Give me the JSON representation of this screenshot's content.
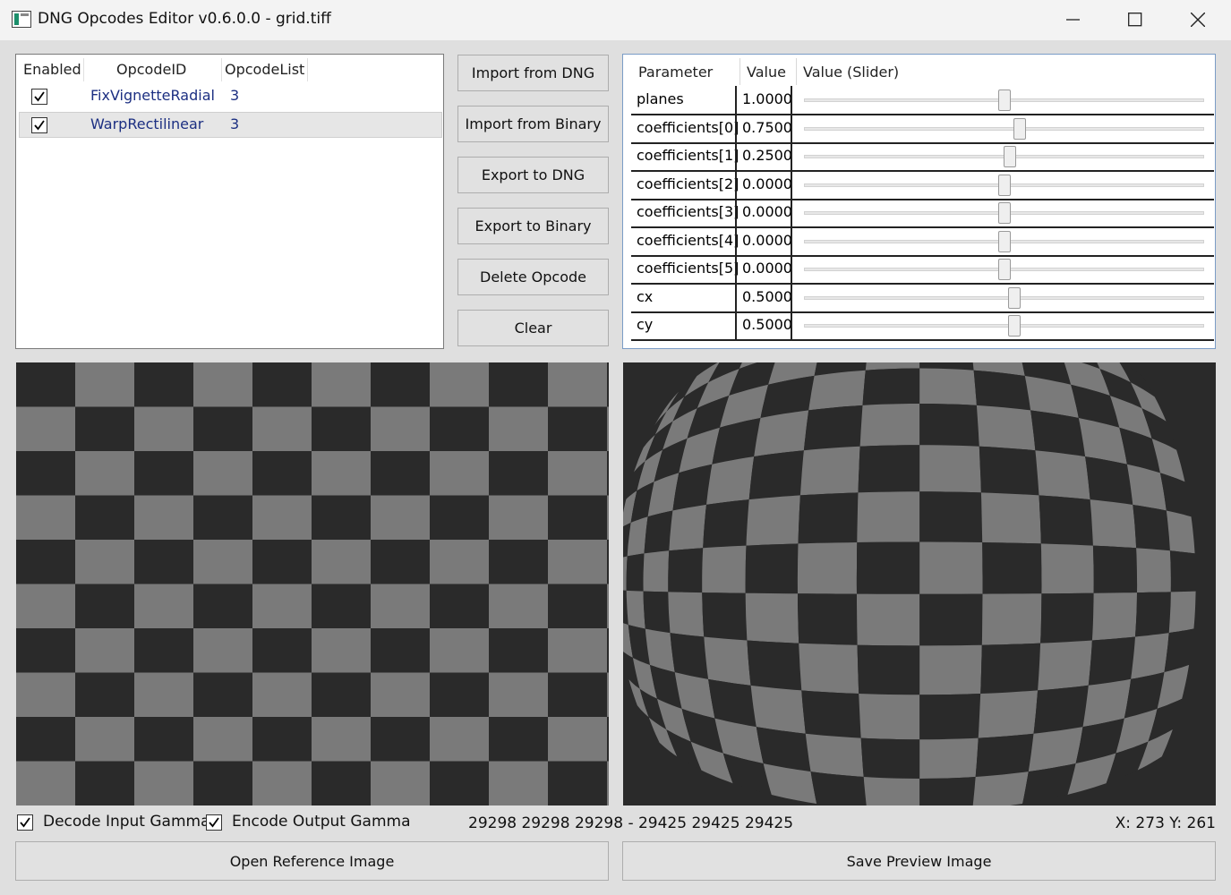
{
  "window": {
    "title": "DNG Opcodes Editor v0.6.0.0 - grid.tiff"
  },
  "opcode_list": {
    "columns": [
      "Enabled",
      "OpcodeID",
      "OpcodeList"
    ],
    "rows": [
      {
        "enabled": true,
        "opcode_id": "FixVignetteRadial",
        "opcode_list": "3"
      },
      {
        "enabled": true,
        "opcode_id": "WarpRectilinear",
        "opcode_list": "3",
        "selected": true
      }
    ]
  },
  "actions": {
    "import_dng": "Import from DNG",
    "import_binary": "Import from Binary",
    "export_dng": "Export to DNG",
    "export_binary": "Export to Binary",
    "delete_opcode": "Delete Opcode",
    "clear": "Clear"
  },
  "parameters": {
    "columns": [
      "Parameter",
      "Value",
      "Value (Slider)"
    ],
    "rows": [
      {
        "name": "planes",
        "value": "1.0000",
        "slider_fraction": 0.5
      },
      {
        "name": "coefficients[0]",
        "value": "0.7500",
        "slider_fraction": 0.54
      },
      {
        "name": "coefficients[1]",
        "value": "0.2500",
        "slider_fraction": 0.515
      },
      {
        "name": "coefficients[2]",
        "value": "0.0000",
        "slider_fraction": 0.5
      },
      {
        "name": "coefficients[3]",
        "value": "0.0000",
        "slider_fraction": 0.5
      },
      {
        "name": "coefficients[4]",
        "value": "0.0000",
        "slider_fraction": 0.5
      },
      {
        "name": "coefficients[5]",
        "value": "0.0000",
        "slider_fraction": 0.5
      },
      {
        "name": "cx",
        "value": "0.5000",
        "slider_fraction": 0.525
      },
      {
        "name": "cy",
        "value": "0.5000",
        "slider_fraction": 0.525
      }
    ]
  },
  "options": {
    "decode_input_gamma": {
      "label": "Decode Input Gamma",
      "checked": true
    },
    "encode_output_gamma": {
      "label": "Encode Output Gamma",
      "checked": true
    }
  },
  "status": {
    "pixel_values": "29298 29298 29298 - 29425 29425 29425",
    "coordinates": "X: 273 Y: 261"
  },
  "bottom_buttons": {
    "open_reference": "Open Reference Image",
    "save_preview": "Save Preview Image"
  },
  "colors": {
    "checker_dark": "#2a2a2a",
    "checker_light": "#7a7a7a",
    "opcode_text": "#1c2f82"
  }
}
